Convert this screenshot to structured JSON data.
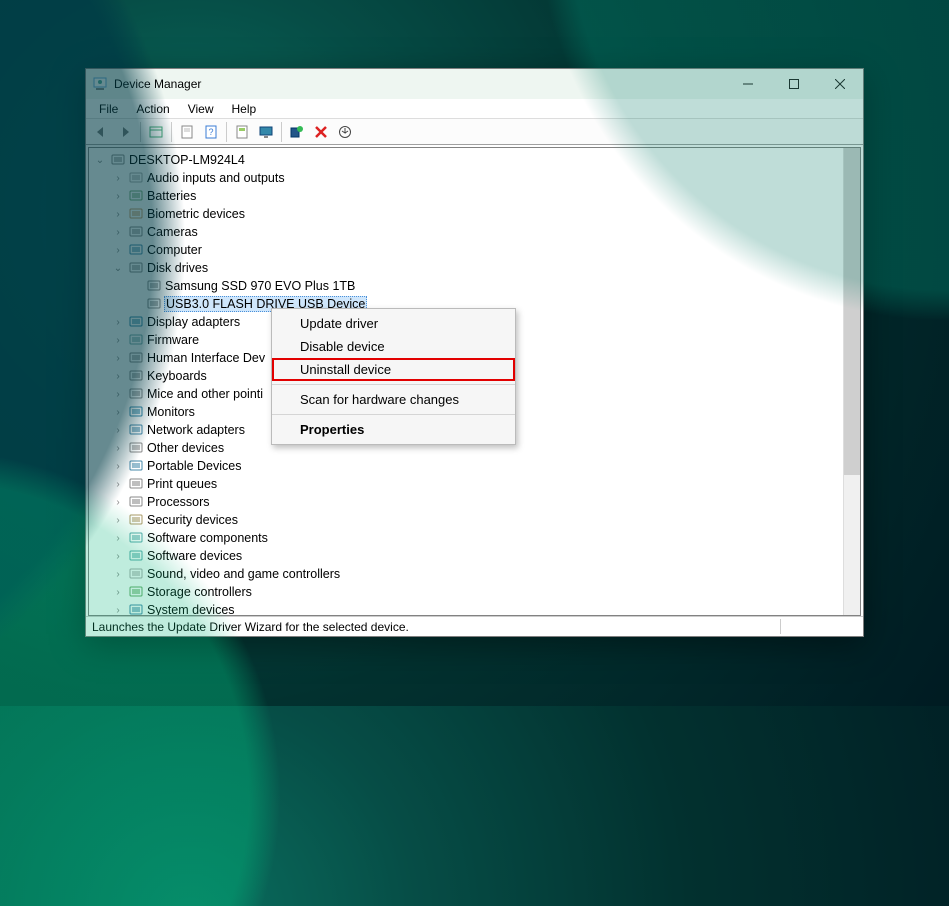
{
  "window": {
    "title": "Device Manager"
  },
  "menu": {
    "file": "File",
    "action": "Action",
    "view": "View",
    "help": "Help"
  },
  "toolbar": {
    "back": "Back",
    "forward": "Forward",
    "show_hidden": "Show hidden",
    "properties": "Properties",
    "help": "Help",
    "refresh": "Refresh",
    "monitor": "Display",
    "scan": "Scan for hardware changes",
    "add": "Add legacy hardware",
    "remove": "Remove",
    "update": "Update driver"
  },
  "root": {
    "name": "DESKTOP-LM924L4"
  },
  "categories": [
    {
      "label": "Audio inputs and outputs",
      "icon": "speaker"
    },
    {
      "label": "Batteries",
      "icon": "battery"
    },
    {
      "label": "Biometric devices",
      "icon": "biometric"
    },
    {
      "label": "Cameras",
      "icon": "camera"
    },
    {
      "label": "Computer",
      "icon": "computer"
    },
    {
      "label": "Disk drives",
      "icon": "disk",
      "expanded": true,
      "children": [
        {
          "label": "Samsung SSD 970 EVO Plus 1TB",
          "icon": "disk"
        },
        {
          "label": "USB3.0 FLASH DRIVE USB Device",
          "icon": "disk",
          "selected": true
        }
      ]
    },
    {
      "label": "Display adapters",
      "icon": "display"
    },
    {
      "label": "Firmware",
      "icon": "firmware"
    },
    {
      "label": "Human Interface Dev",
      "truncated_full": "Human Interface Devices",
      "icon": "hid"
    },
    {
      "label": "Keyboards",
      "icon": "keyboard"
    },
    {
      "label": "Mice and other pointi",
      "truncated_full": "Mice and other pointing devices",
      "icon": "mouse"
    },
    {
      "label": "Monitors",
      "icon": "monitor"
    },
    {
      "label": "Network adapters",
      "icon": "network"
    },
    {
      "label": "Other devices",
      "icon": "other"
    },
    {
      "label": "Portable Devices",
      "icon": "portable"
    },
    {
      "label": "Print queues",
      "icon": "printer"
    },
    {
      "label": "Processors",
      "icon": "cpu"
    },
    {
      "label": "Security devices",
      "icon": "security"
    },
    {
      "label": "Software components",
      "icon": "softcomp"
    },
    {
      "label": "Software devices",
      "icon": "softdev"
    },
    {
      "label": "Sound, video and game controllers",
      "icon": "sound"
    },
    {
      "label": "Storage controllers",
      "icon": "storage"
    },
    {
      "label": "System devices",
      "icon": "system"
    }
  ],
  "context_menu": {
    "items": [
      {
        "label": "Update driver"
      },
      {
        "label": "Disable device"
      },
      {
        "label": "Uninstall device",
        "highlighted": true
      },
      {
        "separator": true
      },
      {
        "label": "Scan for hardware changes"
      },
      {
        "separator": true
      },
      {
        "label": "Properties",
        "bold": true
      }
    ]
  },
  "status_bar": {
    "text": "Launches the Update Driver Wizard for the selected device."
  }
}
